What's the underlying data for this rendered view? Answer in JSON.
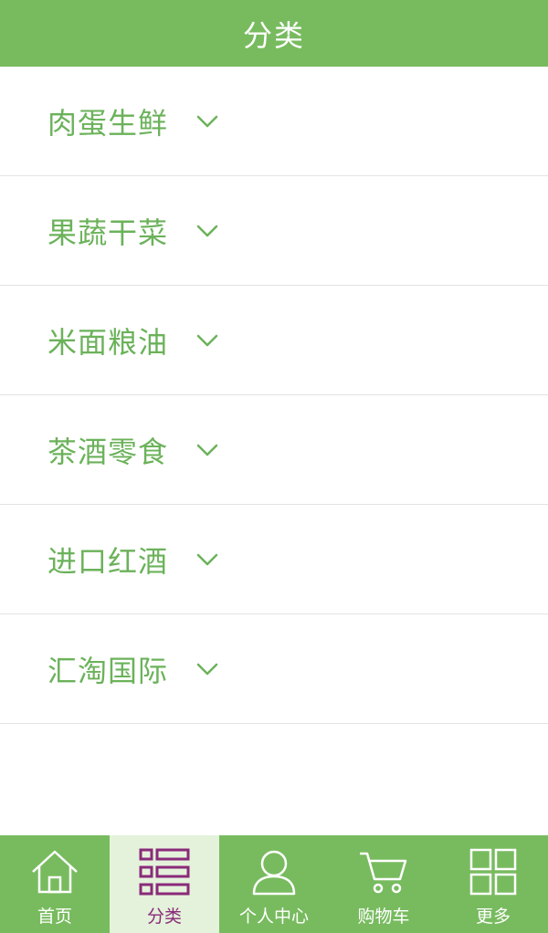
{
  "header": {
    "title": "分类"
  },
  "categories": [
    {
      "label": "肉蛋生鲜"
    },
    {
      "label": "果蔬干菜"
    },
    {
      "label": "米面粮油"
    },
    {
      "label": "茶酒零食"
    },
    {
      "label": "进口红酒"
    },
    {
      "label": "汇淘国际"
    }
  ],
  "tabbar": {
    "tabs": [
      {
        "label": "首页",
        "icon": "home-icon"
      },
      {
        "label": "分类",
        "icon": "category-list-icon",
        "active": true
      },
      {
        "label": "个人中心",
        "icon": "user-icon"
      },
      {
        "label": "购物车",
        "icon": "cart-icon"
      },
      {
        "label": "更多",
        "icon": "grid-icon"
      }
    ]
  },
  "colors": {
    "brand_green": "#78bb5f",
    "text_green": "#6bb25a",
    "active_tab_bg": "#e4f2db",
    "active_tab_accent": "#8a2a7a",
    "divider": "#e3e3e3"
  }
}
